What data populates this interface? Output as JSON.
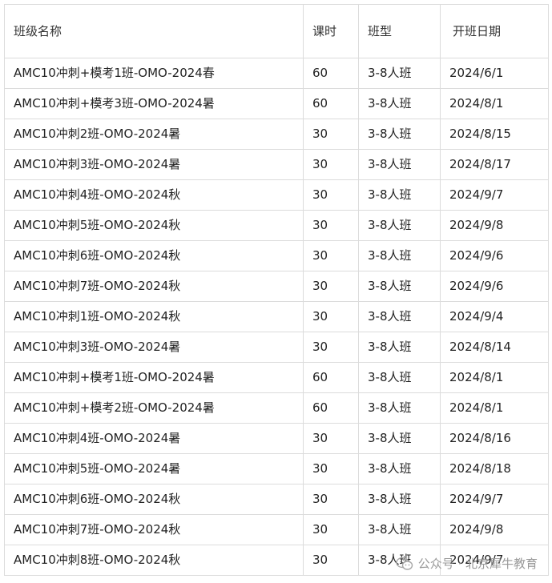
{
  "table": {
    "headers": [
      "班级名称",
      "课时",
      "班型",
      "开班日期"
    ],
    "rows": [
      [
        "AMC10冲刺+模考1班-OMO-2024春",
        "60",
        "3-8人班",
        "2024/6/1"
      ],
      [
        "AMC10冲刺+模考3班-OMO-2024暑",
        "60",
        "3-8人班",
        "2024/8/1"
      ],
      [
        "AMC10冲刺2班-OMO-2024暑",
        "30",
        "3-8人班",
        "2024/8/15"
      ],
      [
        "AMC10冲刺3班-OMO-2024暑",
        "30",
        "3-8人班",
        "2024/8/17"
      ],
      [
        "AMC10冲刺4班-OMO-2024秋",
        "30",
        "3-8人班",
        "2024/9/7"
      ],
      [
        "AMC10冲刺5班-OMO-2024秋",
        "30",
        "3-8人班",
        "2024/9/8"
      ],
      [
        "AMC10冲刺6班-OMO-2024秋",
        "30",
        "3-8人班",
        "2024/9/6"
      ],
      [
        "AMC10冲刺7班-OMO-2024秋",
        "30",
        "3-8人班",
        "2024/9/6"
      ],
      [
        "AMC10冲刺1班-OMO-2024秋",
        "30",
        "3-8人班",
        "2024/9/4"
      ],
      [
        "AMC10冲刺3班-OMO-2024暑",
        "30",
        "3-8人班",
        "2024/8/14"
      ],
      [
        "AMC10冲刺+模考1班-OMO-2024暑",
        "60",
        "3-8人班",
        "2024/8/1"
      ],
      [
        "AMC10冲刺+模考2班-OMO-2024暑",
        "60",
        "3-8人班",
        "2024/8/1"
      ],
      [
        "AMC10冲刺4班-OMO-2024暑",
        "30",
        "3-8人班",
        "2024/8/16"
      ],
      [
        "AMC10冲刺5班-OMO-2024暑",
        "30",
        "3-8人班",
        "2024/8/18"
      ],
      [
        "AMC10冲刺6班-OMO-2024秋",
        "30",
        "3-8人班",
        "2024/9/7"
      ],
      [
        "AMC10冲刺7班-OMO-2024秋",
        "30",
        "3-8人班",
        "2024/9/8"
      ],
      [
        "AMC10冲刺8班-OMO-2024秋",
        "30",
        "3-8人班",
        "2024/9/7"
      ]
    ]
  },
  "watermark": {
    "text": "公众号 · 北京犀牛教育",
    "icon": "wechat-icon",
    "color": "#9a9a9a"
  }
}
